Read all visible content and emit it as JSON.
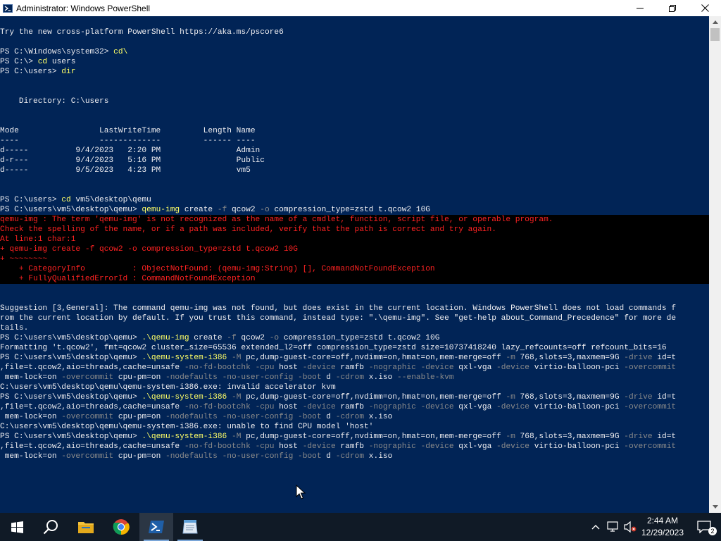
{
  "window": {
    "title": "Administrator: Windows PowerShell"
  },
  "console": {
    "lines": [
      {
        "type": "text",
        "segments": [
          {
            "t": "Try the new cross-platform PowerShell https://aka.ms/pscore6",
            "c": "def"
          }
        ]
      },
      {
        "type": "text",
        "segments": [
          {
            "t": "",
            "c": "def"
          }
        ]
      },
      {
        "type": "text",
        "segments": [
          {
            "t": "PS C:\\Windows\\system32> ",
            "c": "def"
          },
          {
            "t": "cd\\",
            "c": "cmd"
          }
        ]
      },
      {
        "type": "text",
        "segments": [
          {
            "t": "PS C:\\> ",
            "c": "def"
          },
          {
            "t": "cd",
            "c": "cmd"
          },
          {
            "t": " users",
            "c": "def"
          }
        ]
      },
      {
        "type": "text",
        "segments": [
          {
            "t": "PS C:\\users> ",
            "c": "def"
          },
          {
            "t": "dir",
            "c": "cmd"
          }
        ]
      },
      {
        "type": "text",
        "segments": [
          {
            "t": "",
            "c": "def"
          }
        ]
      },
      {
        "type": "text",
        "segments": [
          {
            "t": "",
            "c": "def"
          }
        ]
      },
      {
        "type": "text",
        "segments": [
          {
            "t": "    Directory: C:\\users",
            "c": "def"
          }
        ]
      },
      {
        "type": "text",
        "segments": [
          {
            "t": "",
            "c": "def"
          }
        ]
      },
      {
        "type": "text",
        "segments": [
          {
            "t": "",
            "c": "def"
          }
        ]
      },
      {
        "type": "text",
        "segments": [
          {
            "t": "Mode                 LastWriteTime         Length Name",
            "c": "def"
          }
        ]
      },
      {
        "type": "text",
        "segments": [
          {
            "t": "----                 -------------         ------ ----",
            "c": "def"
          }
        ]
      },
      {
        "type": "text",
        "segments": [
          {
            "t": "d-----          9/4/2023   2:20 PM                Admin",
            "c": "def"
          }
        ]
      },
      {
        "type": "text",
        "segments": [
          {
            "t": "d-r---          9/4/2023   5:16 PM                Public",
            "c": "def"
          }
        ]
      },
      {
        "type": "text",
        "segments": [
          {
            "t": "d-----          9/5/2023   4:23 PM                vm5",
            "c": "def"
          }
        ]
      },
      {
        "type": "text",
        "segments": [
          {
            "t": "",
            "c": "def"
          }
        ]
      },
      {
        "type": "text",
        "segments": [
          {
            "t": "",
            "c": "def"
          }
        ]
      },
      {
        "type": "text",
        "segments": [
          {
            "t": "PS C:\\users> ",
            "c": "def"
          },
          {
            "t": "cd",
            "c": "cmd"
          },
          {
            "t": " vm5\\desktop\\qemu",
            "c": "def"
          }
        ]
      },
      {
        "type": "text",
        "segments": [
          {
            "t": "PS C:\\users\\vm5\\desktop\\qemu> ",
            "c": "def"
          },
          {
            "t": "qemu-img",
            "c": "cmd"
          },
          {
            "t": " create ",
            "c": "def"
          },
          {
            "t": "-f",
            "c": "param"
          },
          {
            "t": " qcow2 ",
            "c": "def"
          },
          {
            "t": "-o",
            "c": "param"
          },
          {
            "t": " compression_type=zstd t.qcow2 10G",
            "c": "def"
          }
        ]
      },
      {
        "type": "err",
        "segments": [
          {
            "t": "qemu-img : The term 'qemu-img' is not recognized as the name of a cmdlet, function, script file, or operable program.",
            "c": "err"
          }
        ]
      },
      {
        "type": "err",
        "segments": [
          {
            "t": "Check the spelling of the name, or if a path was included, verify that the path is correct and try again.",
            "c": "err"
          }
        ]
      },
      {
        "type": "err",
        "segments": [
          {
            "t": "At line:1 char:1",
            "c": "err"
          }
        ]
      },
      {
        "type": "err",
        "segments": [
          {
            "t": "+ qemu-img create -f qcow2 -o compression_type=zstd t.qcow2 10G",
            "c": "err"
          }
        ]
      },
      {
        "type": "err",
        "segments": [
          {
            "t": "+ ~~~~~~~~",
            "c": "err"
          }
        ]
      },
      {
        "type": "err",
        "segments": [
          {
            "t": "    + CategoryInfo          : ObjectNotFound: (qemu-img:String) [], CommandNotFoundException",
            "c": "err"
          }
        ]
      },
      {
        "type": "err",
        "segments": [
          {
            "t": "    + FullyQualifiedErrorId : CommandNotFoundException",
            "c": "err"
          }
        ]
      },
      {
        "type": "text",
        "segments": [
          {
            "t": "",
            "c": "def"
          }
        ]
      },
      {
        "type": "text",
        "segments": [
          {
            "t": "",
            "c": "def"
          }
        ]
      },
      {
        "type": "text",
        "segments": [
          {
            "t": "Suggestion [3,General]: The command qemu-img was not found, but does exist in the current location. Windows PowerShell does not load commands f",
            "c": "def"
          }
        ]
      },
      {
        "type": "text",
        "segments": [
          {
            "t": "rom the current location by default. If you trust this command, instead type: \".\\qemu-img\". See \"get-help about_Command_Precedence\" for more de",
            "c": "def"
          }
        ]
      },
      {
        "type": "text",
        "segments": [
          {
            "t": "tails.",
            "c": "def"
          }
        ]
      },
      {
        "type": "text",
        "segments": [
          {
            "t": "PS C:\\users\\vm5\\desktop\\qemu> ",
            "c": "def"
          },
          {
            "t": ".\\qemu-img",
            "c": "cmd"
          },
          {
            "t": " create ",
            "c": "def"
          },
          {
            "t": "-f",
            "c": "param"
          },
          {
            "t": " qcow2 ",
            "c": "def"
          },
          {
            "t": "-o",
            "c": "param"
          },
          {
            "t": " compression_type=zstd t.qcow2 10G",
            "c": "def"
          }
        ]
      },
      {
        "type": "text",
        "segments": [
          {
            "t": "Formatting 't.qcow2', fmt=qcow2 cluster_size=65536 extended_l2=off compression_type=zstd size=10737418240 lazy_refcounts=off refcount_bits=16",
            "c": "def"
          }
        ]
      },
      {
        "type": "text",
        "segments": [
          {
            "t": "PS C:\\users\\vm5\\desktop\\qemu> ",
            "c": "def"
          },
          {
            "t": ".\\qemu-system-i386",
            "c": "cmd"
          },
          {
            "t": " ",
            "c": "def"
          },
          {
            "t": "-M",
            "c": "param"
          },
          {
            "t": " pc,dump-guest-core=off,nvdimm=on,hmat=on,mem-merge=off ",
            "c": "def"
          },
          {
            "t": "-m",
            "c": "param"
          },
          {
            "t": " 768,slots=3,maxmem=9G ",
            "c": "def"
          },
          {
            "t": "-drive",
            "c": "param"
          },
          {
            "t": " id=t",
            "c": "def"
          }
        ]
      },
      {
        "type": "text",
        "segments": [
          {
            "t": ",file=t.qcow2,aio=threads,cache=unsafe ",
            "c": "def"
          },
          {
            "t": "-no-fd-bootchk",
            "c": "param"
          },
          {
            "t": " ",
            "c": "def"
          },
          {
            "t": "-cpu",
            "c": "param"
          },
          {
            "t": " host ",
            "c": "def"
          },
          {
            "t": "-device",
            "c": "param"
          },
          {
            "t": " ramfb ",
            "c": "def"
          },
          {
            "t": "-nographic",
            "c": "param"
          },
          {
            "t": " ",
            "c": "def"
          },
          {
            "t": "-device",
            "c": "param"
          },
          {
            "t": " qxl-vga ",
            "c": "def"
          },
          {
            "t": "-device",
            "c": "param"
          },
          {
            "t": " virtio-balloon-pci ",
            "c": "def"
          },
          {
            "t": "-overcommit",
            "c": "param"
          }
        ]
      },
      {
        "type": "text",
        "segments": [
          {
            "t": " mem-lock=on ",
            "c": "def"
          },
          {
            "t": "-overcommit",
            "c": "param"
          },
          {
            "t": " cpu-pm=on ",
            "c": "def"
          },
          {
            "t": "-nodefaults",
            "c": "param"
          },
          {
            "t": " ",
            "c": "def"
          },
          {
            "t": "-no-user-config",
            "c": "param"
          },
          {
            "t": " ",
            "c": "def"
          },
          {
            "t": "-boot",
            "c": "param"
          },
          {
            "t": " d ",
            "c": "def"
          },
          {
            "t": "-cdrom",
            "c": "param"
          },
          {
            "t": " x.iso ",
            "c": "def"
          },
          {
            "t": "--enable-kvm",
            "c": "param"
          }
        ]
      },
      {
        "type": "text",
        "segments": [
          {
            "t": "C:\\users\\vm5\\desktop\\qemu\\qemu-system-i386.exe: invalid accelerator kvm",
            "c": "def"
          }
        ]
      },
      {
        "type": "text",
        "segments": [
          {
            "t": "PS C:\\users\\vm5\\desktop\\qemu> ",
            "c": "def"
          },
          {
            "t": ".\\qemu-system-i386",
            "c": "cmd"
          },
          {
            "t": " ",
            "c": "def"
          },
          {
            "t": "-M",
            "c": "param"
          },
          {
            "t": " pc,dump-guest-core=off,nvdimm=on,hmat=on,mem-merge=off ",
            "c": "def"
          },
          {
            "t": "-m",
            "c": "param"
          },
          {
            "t": " 768,slots=3,maxmem=9G ",
            "c": "def"
          },
          {
            "t": "-drive",
            "c": "param"
          },
          {
            "t": " id=t",
            "c": "def"
          }
        ]
      },
      {
        "type": "text",
        "segments": [
          {
            "t": ",file=t.qcow2,aio=threads,cache=unsafe ",
            "c": "def"
          },
          {
            "t": "-no-fd-bootchk",
            "c": "param"
          },
          {
            "t": " ",
            "c": "def"
          },
          {
            "t": "-cpu",
            "c": "param"
          },
          {
            "t": " host ",
            "c": "def"
          },
          {
            "t": "-device",
            "c": "param"
          },
          {
            "t": " ramfb ",
            "c": "def"
          },
          {
            "t": "-nographic",
            "c": "param"
          },
          {
            "t": " ",
            "c": "def"
          },
          {
            "t": "-device",
            "c": "param"
          },
          {
            "t": " qxl-vga ",
            "c": "def"
          },
          {
            "t": "-device",
            "c": "param"
          },
          {
            "t": " virtio-balloon-pci ",
            "c": "def"
          },
          {
            "t": "-overcommit",
            "c": "param"
          }
        ]
      },
      {
        "type": "text",
        "segments": [
          {
            "t": " mem-lock=on ",
            "c": "def"
          },
          {
            "t": "-overcommit",
            "c": "param"
          },
          {
            "t": " cpu-pm=on ",
            "c": "def"
          },
          {
            "t": "-nodefaults",
            "c": "param"
          },
          {
            "t": " ",
            "c": "def"
          },
          {
            "t": "-no-user-config",
            "c": "param"
          },
          {
            "t": " ",
            "c": "def"
          },
          {
            "t": "-boot",
            "c": "param"
          },
          {
            "t": " d ",
            "c": "def"
          },
          {
            "t": "-cdrom",
            "c": "param"
          },
          {
            "t": " x.iso",
            "c": "def"
          }
        ]
      },
      {
        "type": "text",
        "segments": [
          {
            "t": "C:\\users\\vm5\\desktop\\qemu\\qemu-system-i386.exe: unable to find CPU model 'host'",
            "c": "def"
          }
        ]
      },
      {
        "type": "text",
        "segments": [
          {
            "t": "PS C:\\users\\vm5\\desktop\\qemu> ",
            "c": "def"
          },
          {
            "t": ".\\qemu-system-i386",
            "c": "cmd"
          },
          {
            "t": " ",
            "c": "def"
          },
          {
            "t": "-M",
            "c": "param"
          },
          {
            "t": " pc,dump-guest-core=off,nvdimm=on,hmat=on,mem-merge=off ",
            "c": "def"
          },
          {
            "t": "-m",
            "c": "param"
          },
          {
            "t": " 768,slots=3,maxmem=9G ",
            "c": "def"
          },
          {
            "t": "-drive",
            "c": "param"
          },
          {
            "t": " id=t",
            "c": "def"
          }
        ]
      },
      {
        "type": "text",
        "segments": [
          {
            "t": ",file=t.qcow2,aio=threads,cache=unsafe ",
            "c": "def"
          },
          {
            "t": "-no-fd-bootchk",
            "c": "param"
          },
          {
            "t": " ",
            "c": "def"
          },
          {
            "t": "-cpu",
            "c": "param"
          },
          {
            "t": " host ",
            "c": "def"
          },
          {
            "t": "-device",
            "c": "param"
          },
          {
            "t": " ramfb ",
            "c": "def"
          },
          {
            "t": "-nographic",
            "c": "param"
          },
          {
            "t": " ",
            "c": "def"
          },
          {
            "t": "-device",
            "c": "param"
          },
          {
            "t": " qxl-vga ",
            "c": "def"
          },
          {
            "t": "-device",
            "c": "param"
          },
          {
            "t": " virtio-balloon-pci ",
            "c": "def"
          },
          {
            "t": "-overcommit",
            "c": "param"
          }
        ]
      },
      {
        "type": "text",
        "segments": [
          {
            "t": " mem-lock=on ",
            "c": "def"
          },
          {
            "t": "-overcommit",
            "c": "param"
          },
          {
            "t": " cpu-pm=on ",
            "c": "def"
          },
          {
            "t": "-nodefaults",
            "c": "param"
          },
          {
            "t": " ",
            "c": "def"
          },
          {
            "t": "-no-user-config",
            "c": "param"
          },
          {
            "t": " ",
            "c": "def"
          },
          {
            "t": "-boot",
            "c": "param"
          },
          {
            "t": " d ",
            "c": "def"
          },
          {
            "t": "-cdrom",
            "c": "param"
          },
          {
            "t": " x.iso",
            "c": "def"
          }
        ]
      }
    ]
  },
  "taskbar": {
    "apps": [
      {
        "name": "start-button",
        "icon": "windows-logo-icon"
      },
      {
        "name": "search-button",
        "icon": "search-icon"
      },
      {
        "name": "file-explorer",
        "icon": "folder-icon"
      },
      {
        "name": "chrome",
        "icon": "chrome-icon"
      },
      {
        "name": "powershell",
        "icon": "powershell-icon",
        "active": true
      },
      {
        "name": "notepad",
        "icon": "notepad-icon"
      }
    ],
    "clock": {
      "time": "2:44 AM",
      "date": "12/29/2023"
    },
    "notifications_count": "2"
  },
  "colors": {
    "console_bg": "#012456",
    "console_fg": "#eeedf0",
    "command": "#ffff66",
    "parameter": "#8a8a8a",
    "error": "#ff2222",
    "taskbar_bg": "#101a26"
  }
}
